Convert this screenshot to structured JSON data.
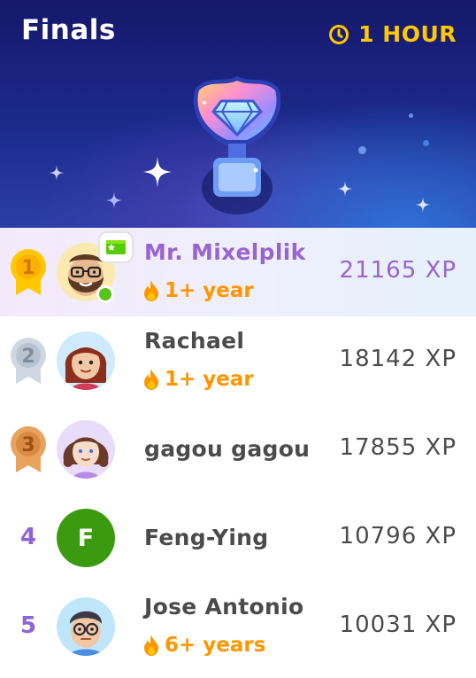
{
  "header": {
    "title": "Finals",
    "timer_label": "1 HOUR",
    "timer_icon": "clock-icon",
    "trophy_icon": "diamond-trophy-icon",
    "colors": {
      "accent": "#ffc800",
      "bg_top": "#16186a",
      "bg_bottom": "#2a3fa6"
    }
  },
  "leaderboard": {
    "rows": [
      {
        "rank": "1",
        "rank_style": "gold-medal",
        "name": "Mr. Mixelplik",
        "streak": "1+ year",
        "xp": "21165 XP",
        "is_current_user": true,
        "online": true,
        "avatar": "bearded-glasses-avatar"
      },
      {
        "rank": "2",
        "rank_style": "silver-medal",
        "name": "Rachael",
        "streak": "1+ year",
        "xp": "18142 XP",
        "avatar": "red-hair-avatar"
      },
      {
        "rank": "3",
        "rank_style": "bronze-medal",
        "name": "gagou gagou",
        "streak": "",
        "xp": "17855 XP",
        "avatar": "curly-hair-avatar"
      },
      {
        "rank": "4",
        "rank_style": "number",
        "name": "Feng-Ying",
        "streak": "",
        "xp": "10796 XP",
        "avatar_letter": "F"
      },
      {
        "rank": "5",
        "rank_style": "number",
        "name": "Jose Antonio",
        "streak": "6+ years",
        "xp": "10031 XP",
        "avatar": "glasses-man-avatar"
      }
    ],
    "colors": {
      "current_user": "#9a63cf",
      "streak": "#ff9600",
      "text": "#4b4b4b",
      "rank_number": "#8e63d6"
    }
  }
}
